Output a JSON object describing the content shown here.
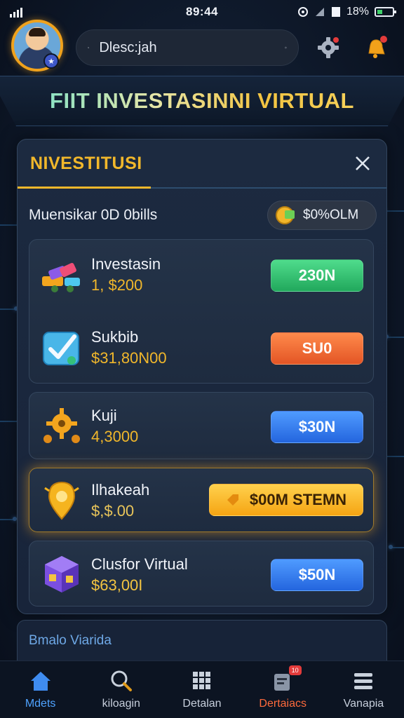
{
  "status_bar": {
    "time": "89:44",
    "battery_text": "18%"
  },
  "top_bar": {
    "search_placeholder": "Dlesc:jah"
  },
  "banner": {
    "title": "FIIT INVESTASINNI VIRTUAL"
  },
  "panel": {
    "title": "NIVESTITUSI",
    "summary_label": "Muensikar 0D 0bills",
    "balance": "$0%OLM"
  },
  "investments": [
    {
      "name": "Investasin",
      "price": "1, $200",
      "button": "230N",
      "button_color": "green",
      "icon": "building-blocks-icon"
    },
    {
      "name": "Sukbib",
      "price": "$31,80N00",
      "button": "SU0",
      "button_color": "orange",
      "icon": "checkbox-icon"
    },
    {
      "name": "Kuji",
      "price": "4,3000",
      "button": "$30N",
      "button_color": "blue",
      "icon": "gears-icon"
    },
    {
      "name": "Ilhakeah",
      "price": "$,$.00",
      "button": "$00M STEMN",
      "button_color": "gold",
      "icon": "lightbulb-pin-icon"
    },
    {
      "name": "Clusfor Virtual",
      "price": "$63,00I",
      "button": "$50N",
      "button_color": "blue",
      "icon": "cube-icon"
    }
  ],
  "hint": {
    "text": "Bmalo Viarida"
  },
  "nav": [
    {
      "label": "Mdets",
      "icon": "home-icon",
      "state": "active"
    },
    {
      "label": "kiloagin",
      "icon": "search-icon",
      "state": "normal"
    },
    {
      "label": "Detalan",
      "icon": "grid-icon",
      "state": "normal"
    },
    {
      "label": "Dertaiacs",
      "icon": "notification-icon",
      "state": "alert",
      "badge": "10"
    },
    {
      "label": "Vanapia",
      "icon": "menu-icon",
      "state": "normal"
    }
  ],
  "colors": {
    "accent_gold": "#f1b72b",
    "accent_blue": "#4fa3ff",
    "background": "#0f1a2c"
  }
}
